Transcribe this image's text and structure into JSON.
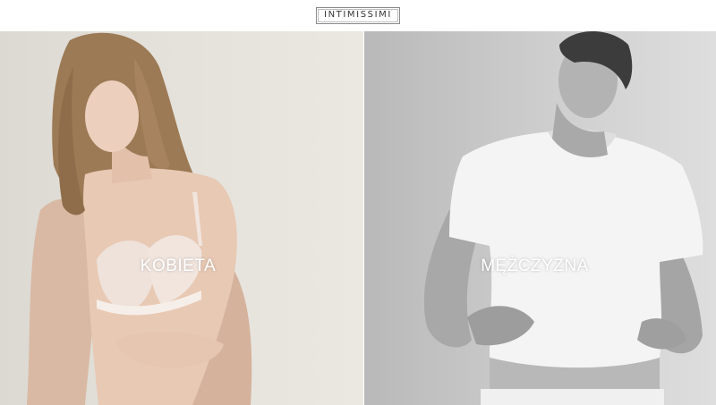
{
  "header": {
    "logo_text": "INTIMISSIMI"
  },
  "panels": {
    "women": {
      "label": "KOBIETA"
    },
    "men": {
      "label": "MĘŻCZYZNA"
    }
  },
  "colors": {
    "background": "#ffffff",
    "label_text": "#ffffff",
    "logo_border": "#8a8a8a"
  }
}
